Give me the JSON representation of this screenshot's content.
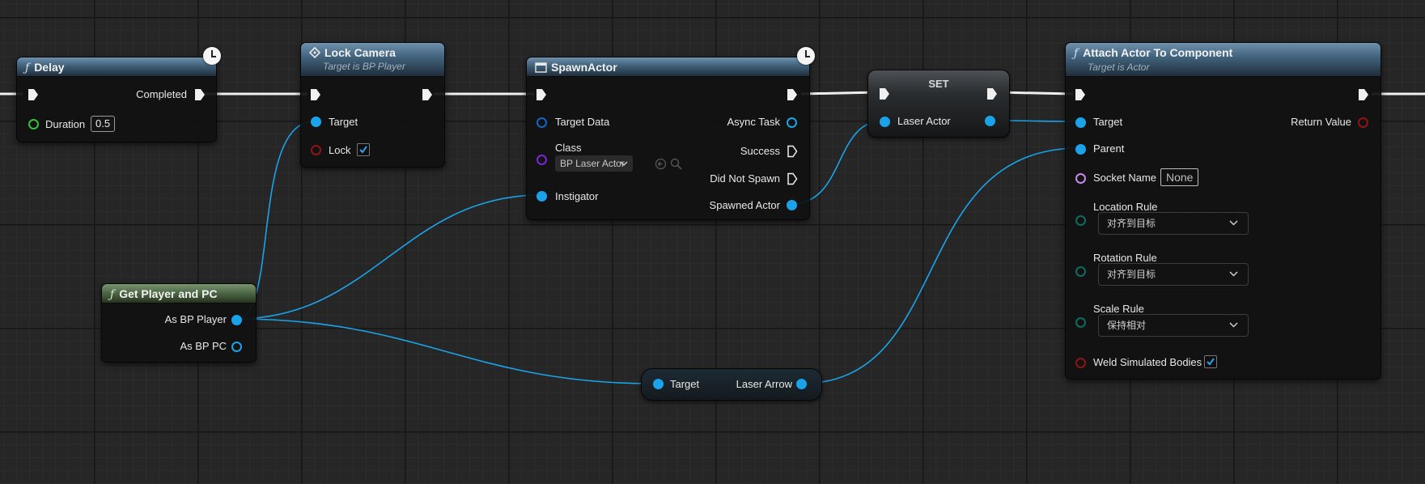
{
  "colors": {
    "exec": "#f0f0f0",
    "object_pin": "#1aa3ea",
    "class_pin": "#7a26d6",
    "float_pin": "#35c23a",
    "bool_pin": "#8e1515",
    "name_pin": "#c889e8",
    "enum_pin": "#0f6a61",
    "interface_pin": "#1463c8"
  },
  "nodes": {
    "delay": {
      "icon": "function-icon",
      "title": "Delay",
      "completed": "Completed",
      "duration_label": "Duration",
      "duration_value": "0.5"
    },
    "lock_camera": {
      "icon": "event-diamond-icon",
      "title": "Lock Camera",
      "subtitle": "Target is BP Player",
      "target_label": "Target",
      "lock_label": "Lock",
      "lock_checked": true
    },
    "spawn_actor": {
      "icon": "spawn-actor-icon",
      "title": "SpawnActor",
      "target_data": "Target Data",
      "class_label": "Class",
      "class_value": "BP Laser Actor",
      "instigator": "Instigator",
      "async_task": "Async Task",
      "success": "Success",
      "did_not_spawn": "Did Not Spawn",
      "spawned_actor": "Spawned Actor"
    },
    "set": {
      "title": "SET",
      "laser_actor": "Laser Actor"
    },
    "attach": {
      "icon": "function-icon",
      "title": "Attach Actor To Component",
      "subtitle": "Target is Actor",
      "target": "Target",
      "parent": "Parent",
      "socket_name_label": "Socket Name",
      "socket_name_value": "None",
      "return_value": "Return Value",
      "location_rule_label": "Location Rule",
      "location_rule_value": "对齐到目标",
      "rotation_rule_label": "Rotation Rule",
      "rotation_rule_value": "对齐到目标",
      "scale_rule_label": "Scale Rule",
      "scale_rule_value": "保持相对",
      "weld_label": "Weld Simulated Bodies",
      "weld_checked": true
    },
    "get_player": {
      "icon": "function-icon",
      "title": "Get Player and PC",
      "as_bp_player": "As BP Player",
      "as_bp_pc": "As BP PC"
    },
    "laser_arrow": {
      "target": "Target",
      "laser_arrow": "Laser Arrow"
    }
  }
}
